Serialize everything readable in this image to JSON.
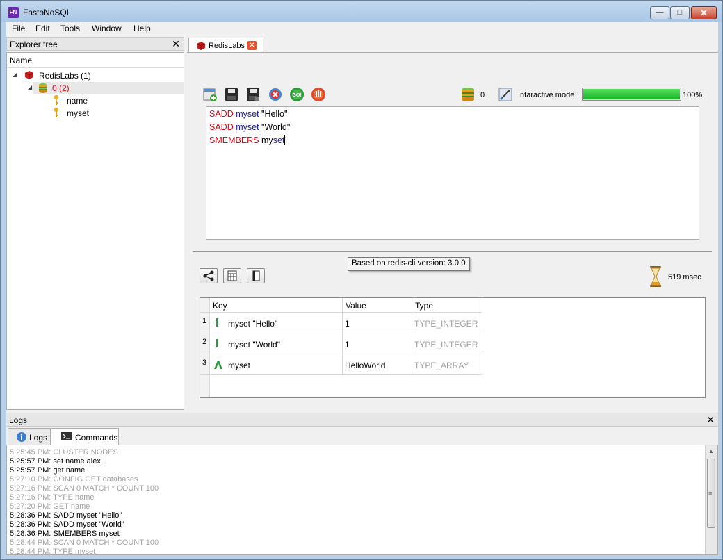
{
  "window": {
    "app_icon_text": "FN",
    "title": "FastoNoSQL"
  },
  "menu": {
    "items": [
      "File",
      "Edit",
      "Tools",
      "Window",
      "Help"
    ]
  },
  "explorer": {
    "title": "Explorer tree",
    "column_header": "Name",
    "server": "RedisLabs (1)",
    "database": "0 (2)",
    "keys": [
      "name",
      "myset"
    ]
  },
  "tab": {
    "label": "RedisLabs"
  },
  "status": {
    "db_count": "0",
    "mode_label": "Intaractive mode",
    "progress_text": "100%",
    "progress_value": 1.0
  },
  "editor": {
    "lines": [
      [
        {
          "t": "SADD",
          "c": "kw"
        },
        {
          "t": " my",
          "c": "id"
        },
        {
          "t": "set",
          "c": "id"
        },
        {
          "t": " \"Hello\"",
          "c": ""
        }
      ],
      [
        {
          "t": "SADD",
          "c": "kw"
        },
        {
          "t": " my",
          "c": "id"
        },
        {
          "t": "set",
          "c": "id"
        },
        {
          "t": " \"World\"",
          "c": ""
        }
      ],
      [
        {
          "t": "SMEMBERS",
          "c": "kw"
        },
        {
          "t": " my",
          "c": ""
        },
        {
          "t": "set",
          "c": "id"
        }
      ]
    ]
  },
  "tooltip": {
    "text": "Based on redis-cli version: 3.0.0"
  },
  "exec_time": "519 msec",
  "results": {
    "headers": [
      "Key",
      "Value",
      "Type"
    ],
    "rows": [
      {
        "num": "1",
        "key": "myset \"Hello\"",
        "value": "1",
        "type": "TYPE_INTEGER",
        "icon": "integer-icon"
      },
      {
        "num": "2",
        "key": "myset \"World\"",
        "value": "1",
        "type": "TYPE_INTEGER",
        "icon": "integer-icon"
      },
      {
        "num": "3",
        "key": "myset",
        "value": "HelloWorld",
        "type": "TYPE_ARRAY",
        "icon": "array-icon"
      }
    ]
  },
  "logs": {
    "title": "Logs",
    "tabs": [
      "Logs",
      "Commands"
    ],
    "lines": [
      {
        "text": "5:25:45 PM: CLUSTER NODES",
        "dim": true
      },
      {
        "text": "5:25:57 PM: set name alex",
        "dim": false
      },
      {
        "text": "5:25:57 PM: get name",
        "dim": false
      },
      {
        "text": "5:27:10 PM: CONFIG GET databases",
        "dim": true
      },
      {
        "text": "5:27:16 PM: SCAN 0 MATCH * COUNT 100",
        "dim": true
      },
      {
        "text": "5:27:16 PM: TYPE name",
        "dim": true
      },
      {
        "text": "5:27:20 PM: GET name",
        "dim": true
      },
      {
        "text": "5:28:36 PM: SADD myset \"Hello\"",
        "dim": false
      },
      {
        "text": "5:28:36 PM: SADD myset \"World\"",
        "dim": false
      },
      {
        "text": "5:28:36 PM: SMEMBERS myset",
        "dim": false
      },
      {
        "text": "5:28:44 PM: SCAN 0 MATCH * COUNT 100",
        "dim": true
      },
      {
        "text": "5:28:44 PM: TYPE myset",
        "dim": true
      }
    ]
  },
  "colors": {
    "keyword": "#d0101e",
    "identifier": "#1c1ca0",
    "progress": "#1fbf2f",
    "dim_log": "#a2a2a2"
  }
}
